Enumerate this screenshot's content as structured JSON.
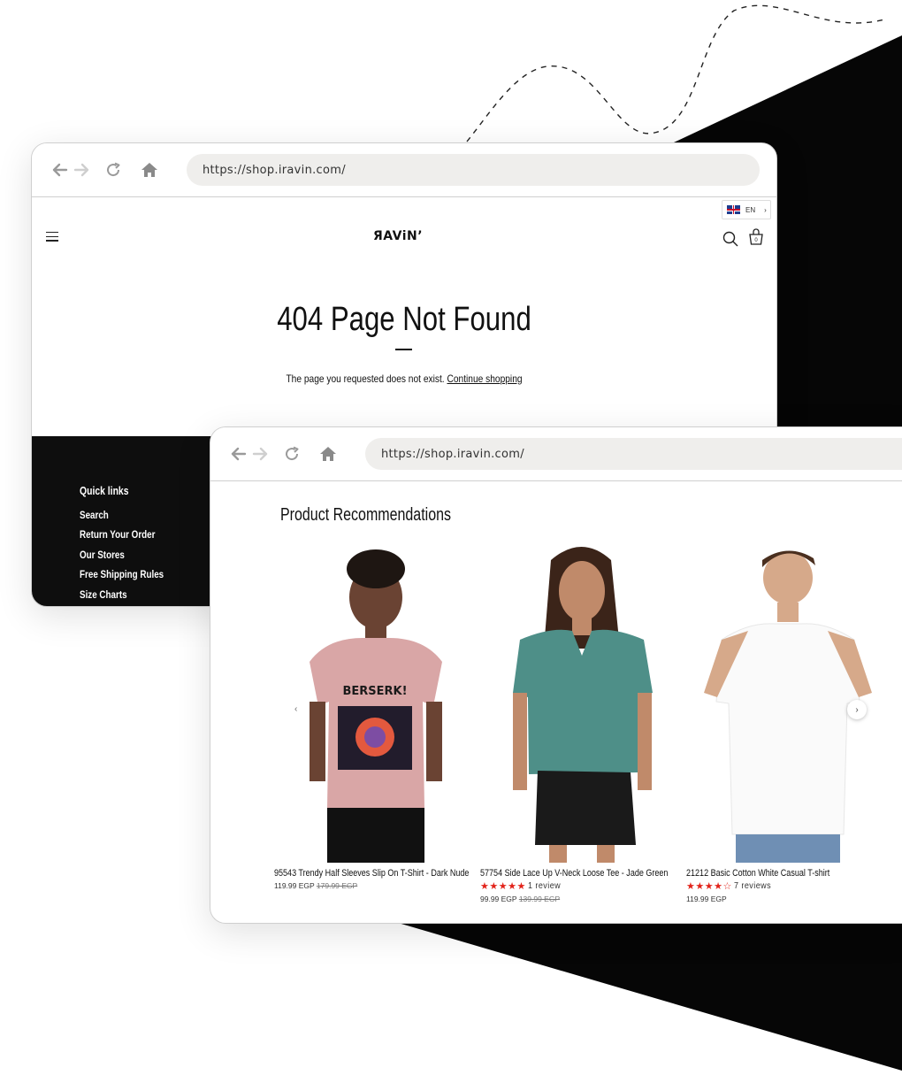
{
  "browser_front": {
    "url": "https://shop.iravin.com/"
  },
  "store": {
    "language": "EN",
    "logo": "ЯAViN’",
    "cart_count": "0",
    "not_found": {
      "title": "404 Page Not Found",
      "message": "The page you requested does not exist.",
      "link_label": "Continue shopping"
    },
    "footer": {
      "quick_links_title": "Quick links",
      "links": [
        "Search",
        "Return Your Order",
        "Our Stores",
        "Free Shipping Rules",
        "Size Charts"
      ]
    }
  },
  "browser_back": {
    "url": "https://shop.iravin.com/"
  },
  "recommendations": {
    "title": "Product Recommendations",
    "products": [
      {
        "name": "95543 Trendy Half Sleeves Slip On T-Shirt - Dark Nude",
        "price": "119.99 EGP",
        "compare_price": "179.99 EGP",
        "rating": 0,
        "reviews": ""
      },
      {
        "name": "57754 Side Lace Up V-Neck Loose Tee - Jade Green",
        "price": "99.99 EGP",
        "compare_price": "139.99 EGP",
        "rating": 5,
        "reviews": "1 review"
      },
      {
        "name": "21212 Basic Cotton White Casual T-shirt",
        "price": "119.99 EGP",
        "compare_price": "",
        "rating": 4.5,
        "reviews": "7 reviews"
      }
    ]
  },
  "colors": {
    "footer_bg": "#0e0e0e",
    "url_bar_bg": "#efeeec",
    "star_color": "#e2231a",
    "accent_black": "#060606"
  },
  "icons": [
    "back-arrow-icon",
    "forward-arrow-icon",
    "reload-icon",
    "home-icon",
    "hamburger-menu-icon",
    "search-icon",
    "cart-icon",
    "uk-flag-icon",
    "chevron-right-icon",
    "chevron-left-icon",
    "star-icon"
  ]
}
